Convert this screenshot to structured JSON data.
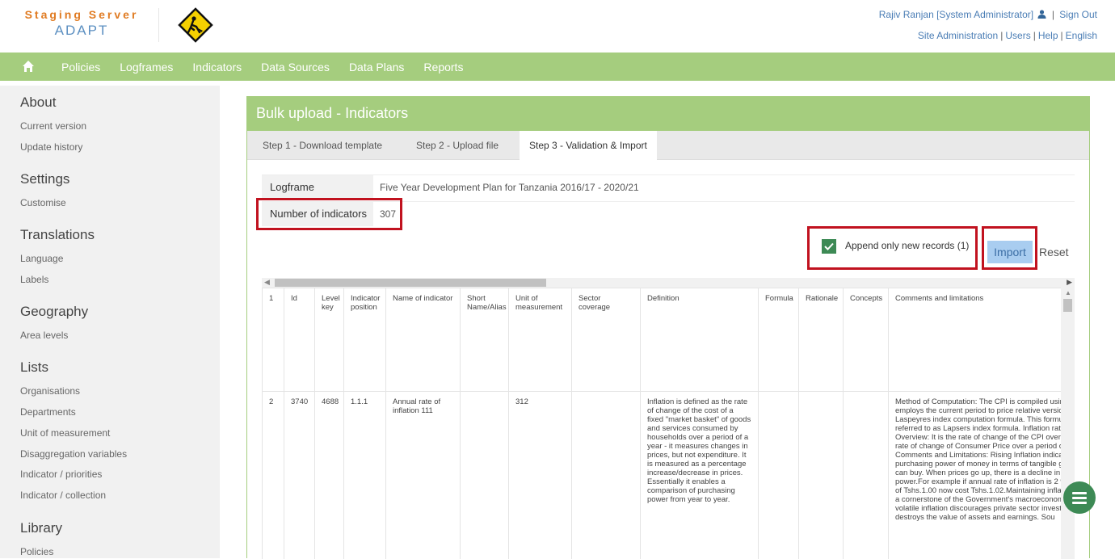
{
  "brand": {
    "line1": "Staging Server",
    "line2": "ADAPT"
  },
  "header": {
    "user": "Rajiv Ranjan [System Administrator]",
    "sign_out": "Sign Out",
    "links": [
      "Site Administration",
      "Users",
      "Help",
      "English"
    ]
  },
  "nav": {
    "items": [
      "Policies",
      "Logframes",
      "Indicators",
      "Data Sources",
      "Data Plans",
      "Reports"
    ]
  },
  "sidebar": {
    "about": "About",
    "about_items": [
      "Current version",
      "Update history"
    ],
    "settings": "Settings",
    "settings_items": [
      "Customise"
    ],
    "translations": "Translations",
    "translations_items": [
      "Language",
      "Labels"
    ],
    "geography": "Geography",
    "geography_items": [
      "Area levels"
    ],
    "lists": "Lists",
    "lists_items": [
      "Organisations",
      "Departments",
      "Unit of measurement",
      "Disaggregation variables",
      "Indicator / priorities",
      "Indicator / collection"
    ],
    "library": "Library",
    "library_items": [
      "Policies"
    ]
  },
  "panel": {
    "title": "Bulk upload - Indicators",
    "tabs": [
      "Step 1 - Download template",
      "Step 2 - Upload file",
      "Step 3 - Validation & Import"
    ],
    "logframe_label": "Logframe",
    "logframe_value": "Five Year Development Plan for Tanzania 2016/17 - 2020/21",
    "count_label": "Number of indicators",
    "count_value": "307",
    "append_label": "Append only new records (1)",
    "append_checked": true,
    "import_label": "Import",
    "reset_label": "Reset"
  },
  "grid": {
    "headers": [
      "1",
      "Id",
      "Level key",
      "Indicator position",
      "Name of indicator",
      "Short Name/Alias",
      "Unit of measurement",
      "Sector coverage",
      "Definition",
      "Formula",
      "Rationale",
      "Concepts",
      "Comments and limitations"
    ],
    "rows": [
      [
        "2",
        "3740",
        "4688",
        "1.1.1",
        "Annual rate of inflation 111",
        "",
        "312",
        "",
        "Inflation is defined as the rate of change of the cost of a fixed \"market basket\" of goods and services consumed by households over a period of a year - it measures changes in prices, but not expenditure. It is measured as a percentage increase/decrease in prices. Essentially it enables a comparison of purchasing power from year to year.",
        "",
        "",
        "",
        "Method of Computation: The CPI is compiled using software that employs the current period to price relative version of the Laspeyres index computation formula. This formula is sometimes referred to as Lapsers index formula. Inflation rate= (CPIx+1 Overview: It is the rate of change of the CPI over a year. It is the rate of change of Consumer Price over a period of a year. Comments and Limitations: Rising Inflation indicates the real purchasing power of money in terms of tangible goods that money can buy. When prices go up, there is a decline in purchasing power.For example if annual rate of inflation is 2 %, then a product of Tshs.1.00 now cost Tshs.1.02.Maintaining inflation at less than is a cornerstone of the Government's macroeconomic policy and volatile inflation discourages private sector investment and destroys the value of assets and earnings. Sou"
      ]
    ]
  },
  "colors": {
    "green": "#a5cd7e",
    "highlight_red": "#c1121f",
    "check_green": "#3d8a55",
    "link_blue": "#4a7db5",
    "brand_orange": "#e07b22"
  },
  "icons": [
    "warning-sign-logo",
    "user-icon",
    "home-icon",
    "check-icon",
    "menu-icon"
  ]
}
